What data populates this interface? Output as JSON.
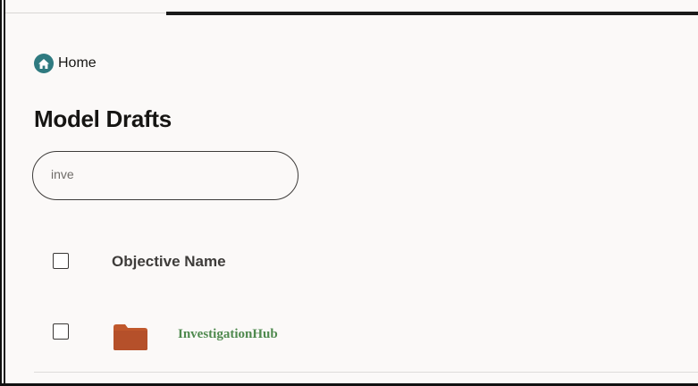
{
  "breadcrumb": {
    "home_label": "Home",
    "icon": "home-icon"
  },
  "page": {
    "title": "Model Drafts"
  },
  "search": {
    "value": "inve",
    "placeholder": ""
  },
  "table": {
    "columns": [
      "Objective Name"
    ],
    "rows": [
      {
        "name": "InvestigationHub",
        "icon": "folder-icon",
        "selected": false
      }
    ]
  },
  "colors": {
    "background": "#fbf9f8",
    "home_icon": "#2f7a80",
    "folder": "#c0582c",
    "link": "#4f8a4f"
  }
}
